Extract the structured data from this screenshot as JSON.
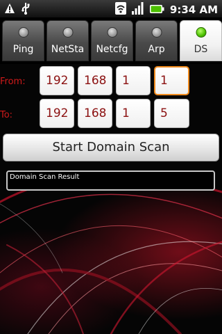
{
  "status_bar": {
    "time": "9:34 AM",
    "icons": [
      "warning-icon",
      "usb-icon",
      "wifi-icon",
      "signal-icon",
      "battery-icon"
    ]
  },
  "tabs": [
    {
      "label": "Ping",
      "active": false
    },
    {
      "label": "NetSta",
      "active": false
    },
    {
      "label": "Netcfg",
      "active": false
    },
    {
      "label": "Arp",
      "active": false
    },
    {
      "label": "DS",
      "active": true
    }
  ],
  "form": {
    "from_label": "From:",
    "to_label": "To:",
    "from": [
      "192",
      "168",
      "1",
      "1"
    ],
    "to": [
      "192",
      "168",
      "1",
      "5"
    ]
  },
  "scan_button": {
    "label": "Start Domain Scan"
  },
  "result": {
    "text": "Domain Scan Result"
  },
  "colors": {
    "label_red": "#d01a1a",
    "value_red": "#8b1010",
    "focus_orange": "#f08a1c",
    "active_indicator": "#4cc000"
  }
}
